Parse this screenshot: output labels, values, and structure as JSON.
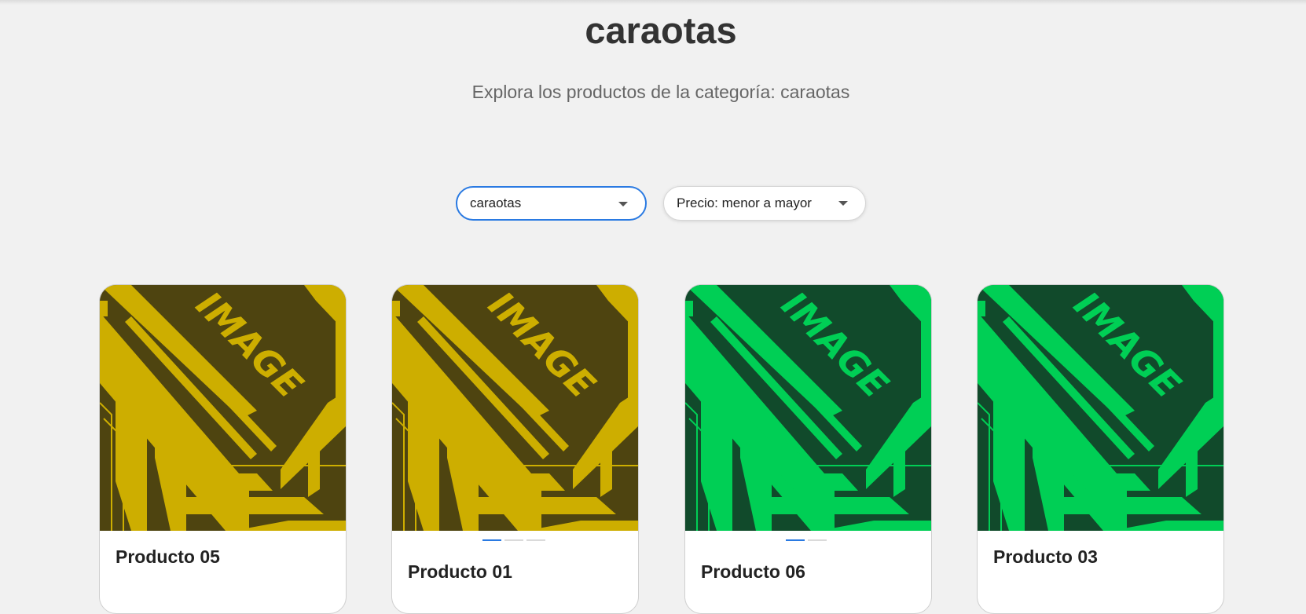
{
  "page": {
    "title": "caraotas",
    "subtitle": "Explora los productos de la categoría: caraotas"
  },
  "filters": {
    "category": {
      "selected": "caraotas"
    },
    "sort": {
      "selected": "Precio: menor a mayor"
    }
  },
  "products": [
    {
      "name": "Producto 05",
      "image_text": "IMAGE",
      "image_bg": "#4e4410",
      "image_fg": "#cdae00",
      "carousel_dots": 0,
      "active_dot": 0
    },
    {
      "name": "Producto 01",
      "image_text": "IMAGE",
      "image_bg": "#4e4410",
      "image_fg": "#cdae00",
      "carousel_dots": 3,
      "active_dot": 0
    },
    {
      "name": "Producto 06",
      "image_text": "IMAGE",
      "image_bg": "#114a2b",
      "image_fg": "#00cf55",
      "carousel_dots": 2,
      "active_dot": 0
    },
    {
      "name": "Producto 03",
      "image_text": "IMAGE",
      "image_bg": "#114a2b",
      "image_fg": "#00cf55",
      "carousel_dots": 0,
      "active_dot": 0
    }
  ],
  "colors": {
    "background": "#f1f1f1",
    "accent": "#2a7ae2"
  }
}
